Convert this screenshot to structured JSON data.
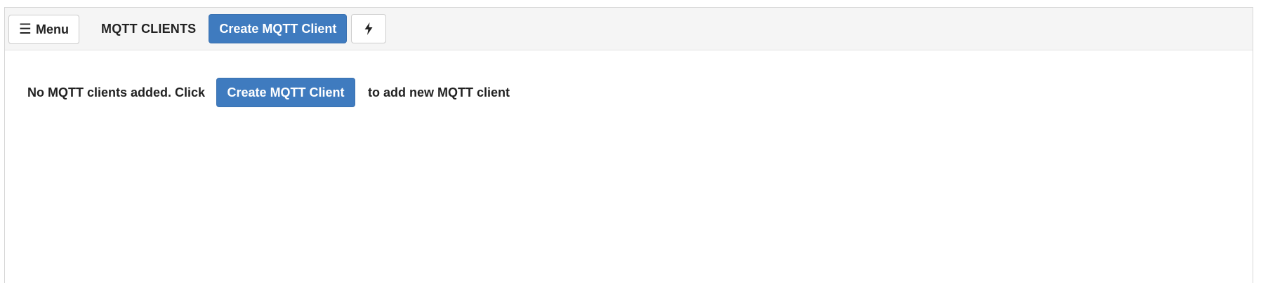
{
  "toolbar": {
    "menu_icon": "hamburger-icon",
    "menu_label": "Menu",
    "title": "MQTT CLIENTS",
    "create_label": "Create MQTT Client",
    "quick_action_icon": "lightning-bolt-icon"
  },
  "empty_state": {
    "prefix": "No MQTT clients added. Click",
    "button_label": "Create MQTT Client",
    "suffix": "to add new MQTT client"
  },
  "colors": {
    "primary": "#3f7bbf",
    "toolbar_bg": "#f5f5f5",
    "text": "#222222"
  }
}
